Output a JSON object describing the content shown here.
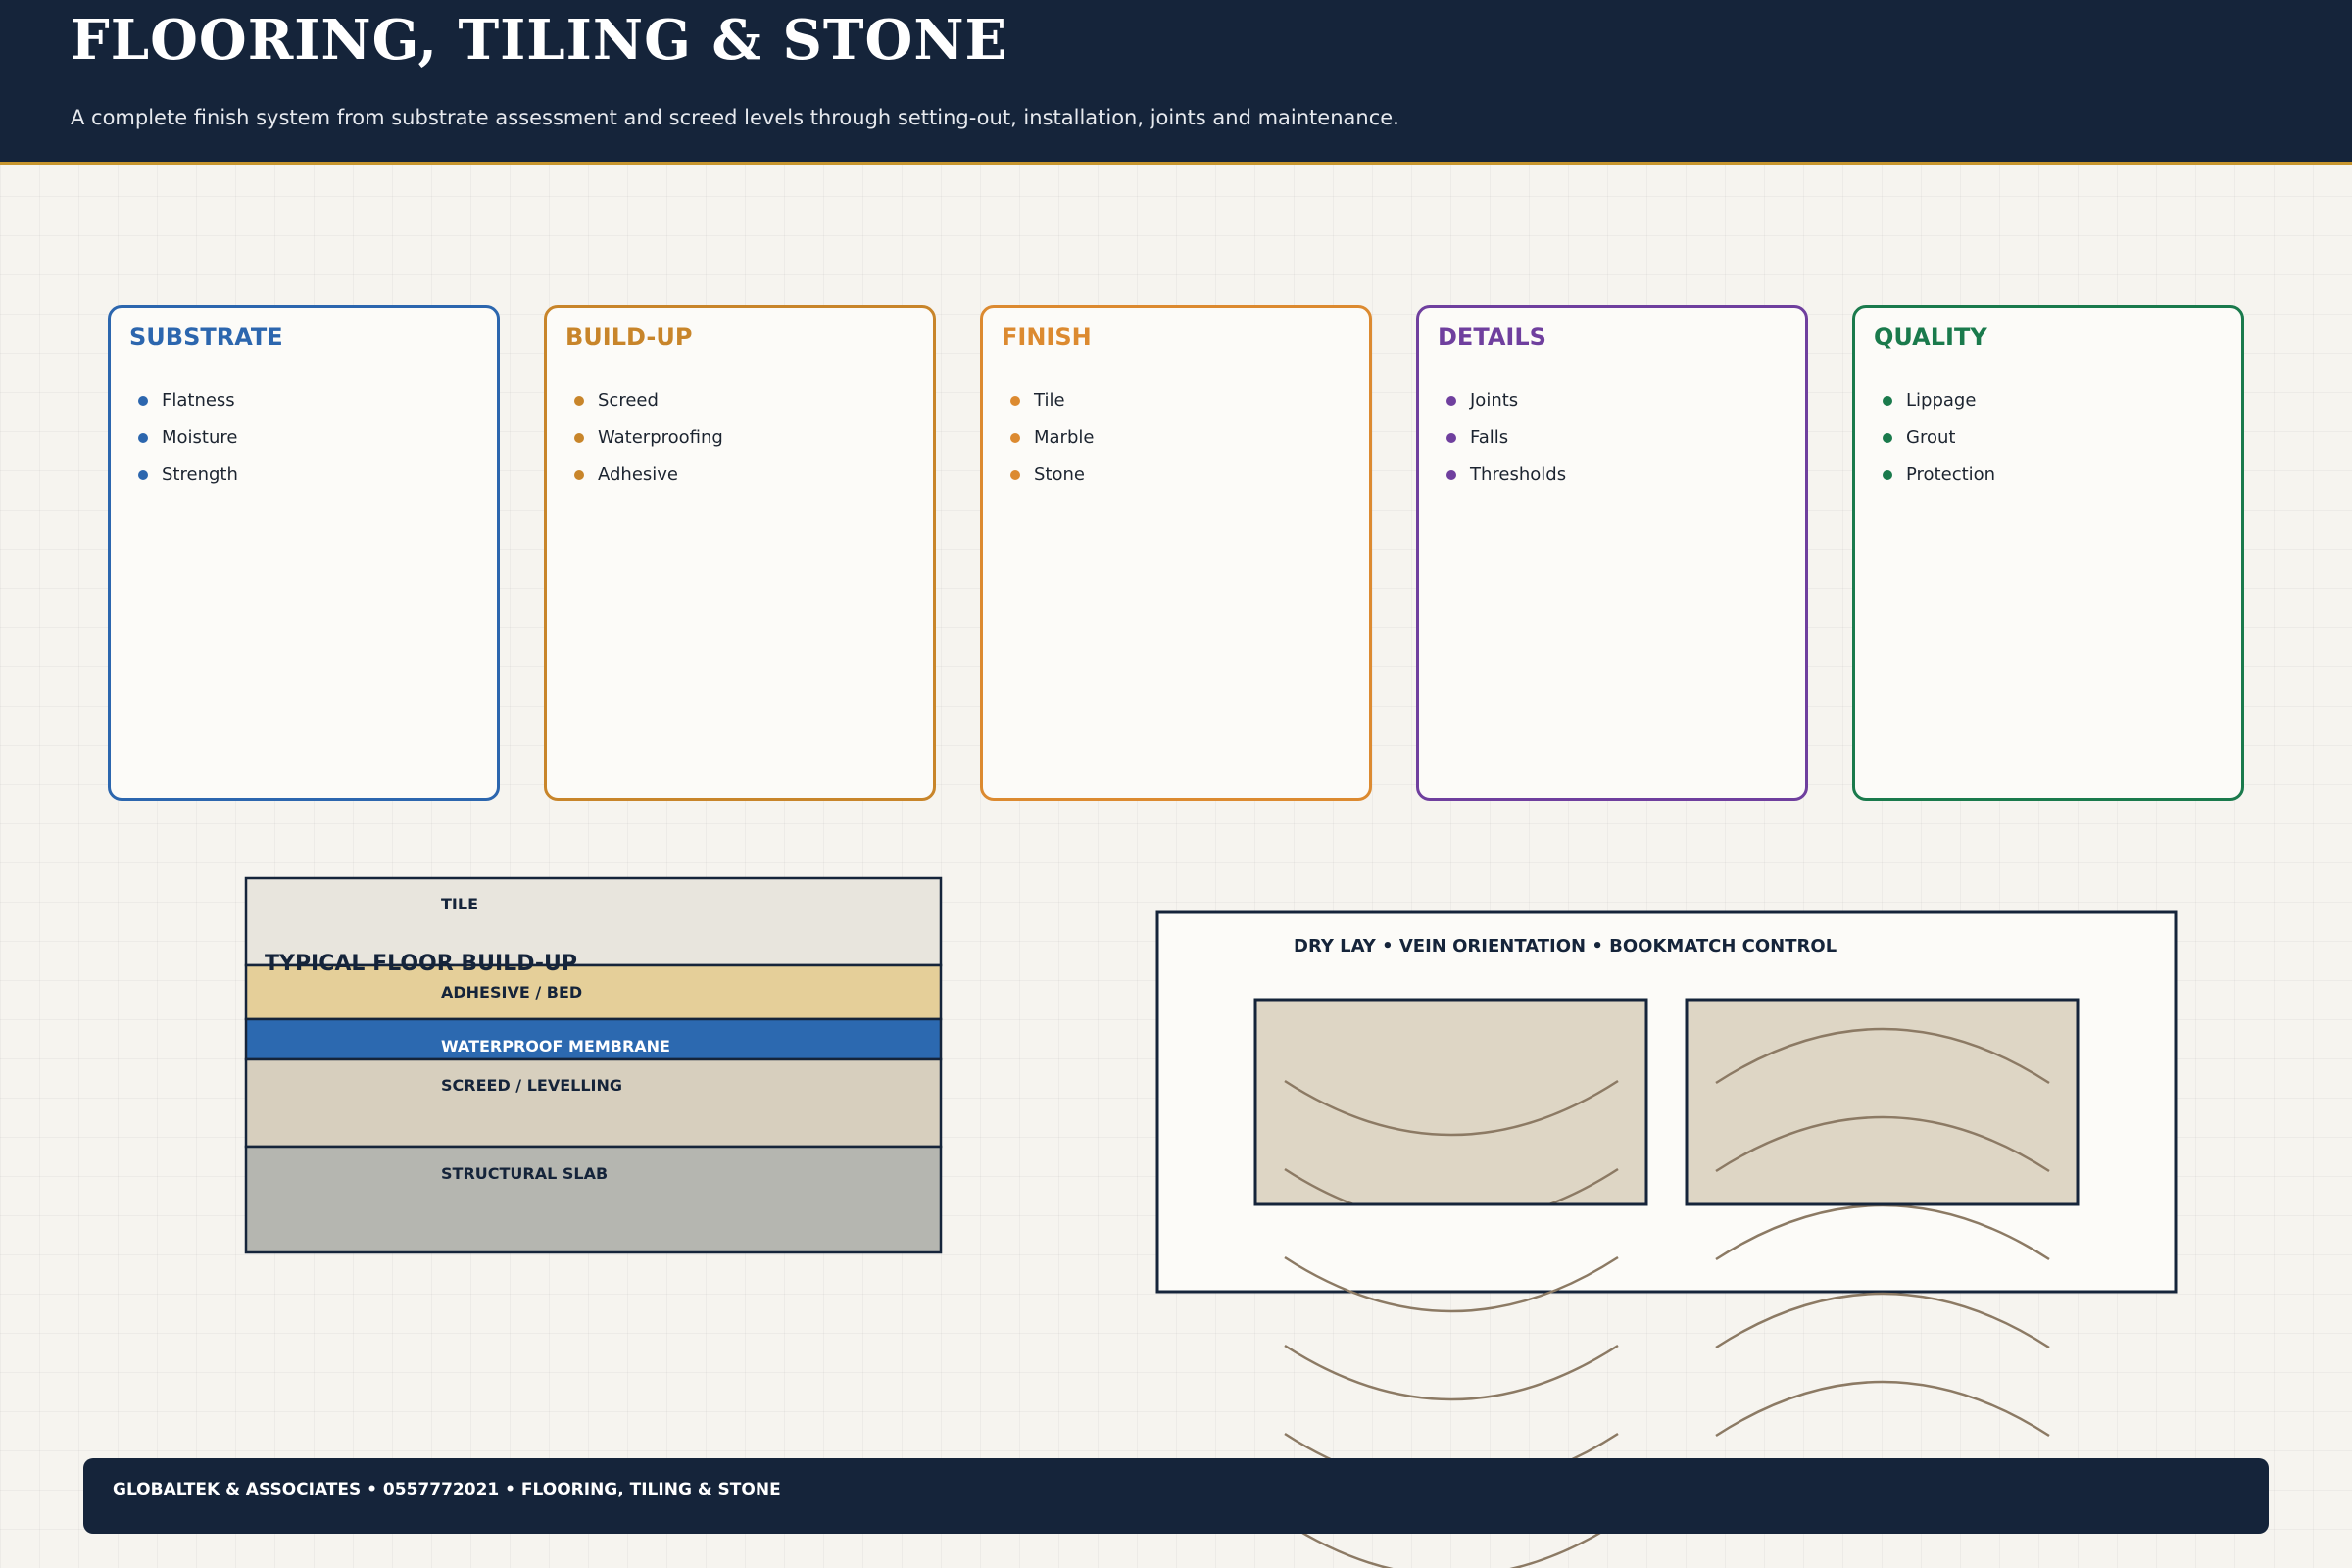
{
  "header": {
    "title": "FLOORING, TILING & STONE",
    "subtitle": "A complete finish system from substrate assessment and screed levels through setting-out, installation, joints and maintenance."
  },
  "categories": [
    {
      "name": "substrate",
      "title": "SUBSTRATE",
      "color": "#2c66ae",
      "items": [
        "Flatness",
        "Moisture",
        "Strength"
      ]
    },
    {
      "name": "build-up",
      "title": "BUILD-UP",
      "color": "#c8852a",
      "items": [
        "Screed",
        "Waterproofing",
        "Adhesive"
      ]
    },
    {
      "name": "finish",
      "title": "FINISH",
      "color": "#dc8a30",
      "items": [
        "Tile",
        "Marble",
        "Stone"
      ]
    },
    {
      "name": "details",
      "title": "DETAILS",
      "color": "#6f3f9e",
      "items": [
        "Joints",
        "Falls",
        "Thresholds"
      ]
    },
    {
      "name": "quality",
      "title": "QUALITY",
      "color": "#1a7a4c",
      "items": [
        "Lippage",
        "Grout",
        "Protection"
      ]
    }
  ],
  "build_up": {
    "title": "TYPICAL FLOOR BUILD-UP",
    "layers": [
      {
        "label": "TILE",
        "fill": "#e8e5dd",
        "text_color": "#15243a"
      },
      {
        "label": "ADHESIVE / BED",
        "fill": "#e5cf99",
        "text_color": "#15243a"
      },
      {
        "label": "WATERPROOF MEMBRANE",
        "fill": "#2c69b0",
        "text_color": "#ffffff"
      },
      {
        "label": "SCREED / LEVELLING",
        "fill": "#d7cfbe",
        "text_color": "#15243a"
      },
      {
        "label": "STRUCTURAL SLAB",
        "fill": "#b5b6b0",
        "text_color": "#15243a"
      }
    ]
  },
  "dry_lay": {
    "title": "DRY LAY • VEIN ORIENTATION • BOOKMATCH CONTROL"
  },
  "footer": {
    "text": "GLOBALTEK & ASSOCIATES • 0557772021 • FLOORING, TILING & STONE"
  }
}
